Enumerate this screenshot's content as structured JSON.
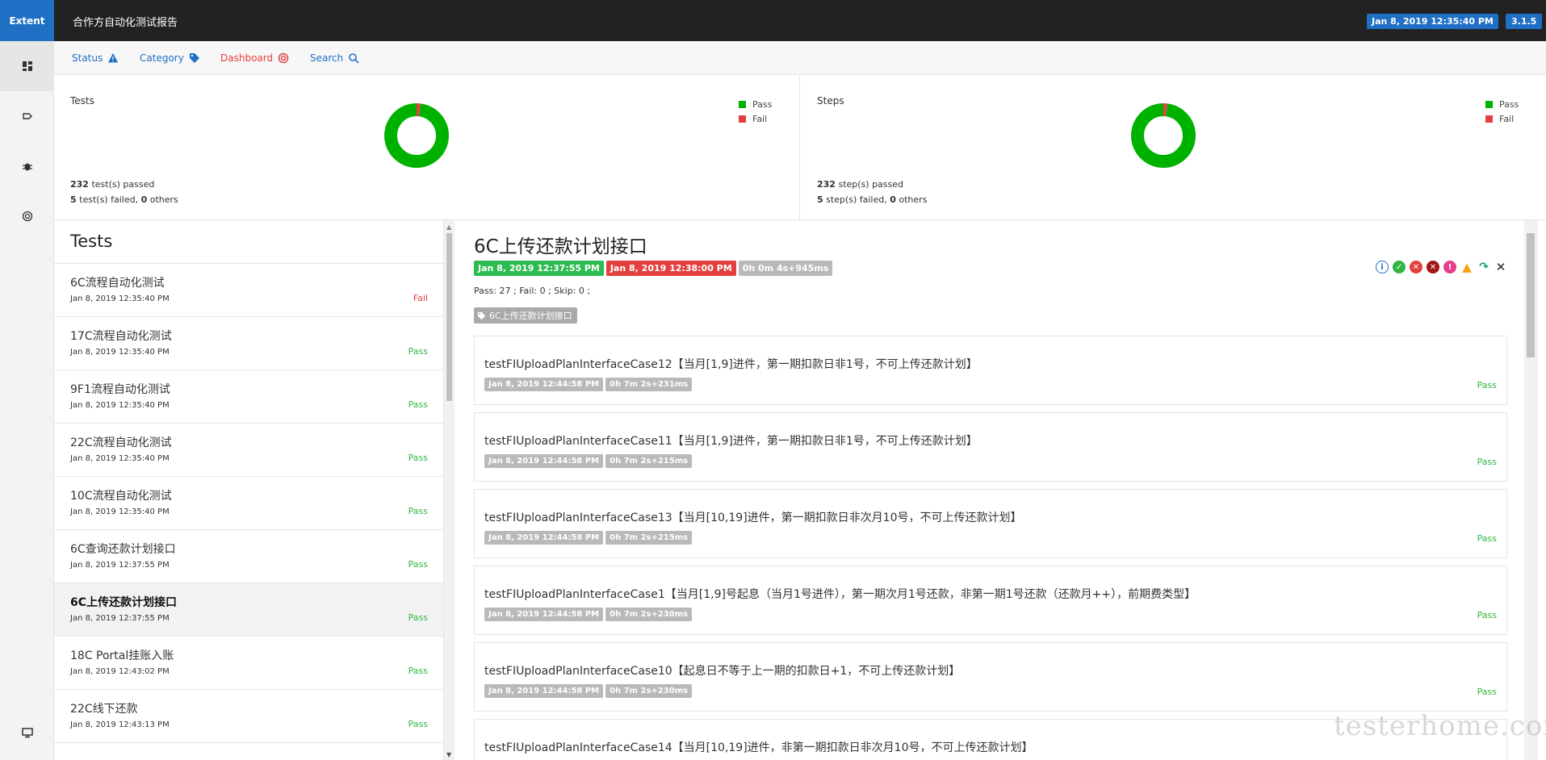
{
  "header": {
    "brand": "Extent",
    "report_name": "合作方自动化测试报告",
    "date": "Jan 8, 2019 12:35:40 PM",
    "version": "3.1.5"
  },
  "sidenav": {
    "items": [
      {
        "icon": "dashboard-grid-icon"
      },
      {
        "icon": "tag-icon"
      },
      {
        "icon": "bug-icon"
      },
      {
        "icon": "target-icon"
      },
      {
        "icon": "monitor-icon"
      }
    ]
  },
  "subnav": {
    "status": "Status",
    "category": "Category",
    "dashboard": "Dashboard",
    "search": "Search"
  },
  "colors": {
    "pass": "#00b200",
    "fail": "#e2403f",
    "accent": "#1f6fc5"
  },
  "dashboard": {
    "tests": {
      "title": "Tests",
      "legend_pass": "Pass",
      "legend_fail": "Fail",
      "passed_count": "232",
      "passed_text": " test(s) passed",
      "failed_count": "5",
      "failed_text": " test(s) failed, ",
      "others_count": "0",
      "others_text": " others",
      "pass_value": 232,
      "fail_value": 5
    },
    "steps": {
      "title": "Steps",
      "legend_pass": "Pass",
      "legend_fail": "Fail",
      "passed_count": "232",
      "passed_text": " step(s) passed",
      "failed_count": "5",
      "failed_text": " step(s) failed, ",
      "others_count": "0",
      "others_text": " others",
      "pass_value": 232,
      "fail_value": 5
    }
  },
  "chart_data": [
    {
      "type": "pie",
      "title": "Tests",
      "categories": [
        "Pass",
        "Fail"
      ],
      "values": [
        232,
        5
      ]
    },
    {
      "type": "pie",
      "title": "Steps",
      "categories": [
        "Pass",
        "Fail"
      ],
      "values": [
        232,
        5
      ]
    }
  ],
  "test_list": {
    "title": "Tests",
    "items": [
      {
        "name": "6C流程自动化测试",
        "time": "Jan 8, 2019 12:35:40 PM",
        "status": "Fail"
      },
      {
        "name": "17C流程自动化测试",
        "time": "Jan 8, 2019 12:35:40 PM",
        "status": "Pass"
      },
      {
        "name": "9F1流程自动化测试",
        "time": "Jan 8, 2019 12:35:40 PM",
        "status": "Pass"
      },
      {
        "name": "22C流程自动化测试",
        "time": "Jan 8, 2019 12:35:40 PM",
        "status": "Pass"
      },
      {
        "name": "10C流程自动化测试",
        "time": "Jan 8, 2019 12:35:40 PM",
        "status": "Pass"
      },
      {
        "name": "6C查询还款计划接口",
        "time": "Jan 8, 2019 12:37:55 PM",
        "status": "Pass"
      },
      {
        "name": "6C上传还款计划接口",
        "time": "Jan 8, 2019 12:37:55 PM",
        "status": "Pass"
      },
      {
        "name": "18C Portal挂账入账",
        "time": "Jan 8, 2019 12:43:02 PM",
        "status": "Pass"
      },
      {
        "name": "22C线下还款",
        "time": "Jan 8, 2019 12:43:13 PM",
        "status": "Pass"
      }
    ]
  },
  "detail": {
    "title": "6C上传还款计划接口",
    "start": "Jan 8, 2019 12:37:55 PM",
    "end": "Jan 8, 2019 12:38:00 PM",
    "duration": "0h 0m 4s+945ms",
    "counts": "Pass: 27 ; Fail: 0 ; Skip: 0 ;",
    "tag": "6C上传还款计划接口",
    "nodes": [
      {
        "name": "testFIUploadPlanInterfaceCase12【当月[1,9]进件，第一期扣款日非1号，不可上传还款计划】",
        "time": "Jan 8, 2019 12:44:58 PM",
        "duration": "0h 7m 2s+231ms",
        "status": "Pass"
      },
      {
        "name": "testFIUploadPlanInterfaceCase11【当月[1,9]进件，第一期扣款日非1号，不可上传还款计划】",
        "time": "Jan 8, 2019 12:44:58 PM",
        "duration": "0h 7m 2s+215ms",
        "status": "Pass"
      },
      {
        "name": "testFIUploadPlanInterfaceCase13【当月[10,19]进件，第一期扣款日非次月10号，不可上传还款计划】",
        "time": "Jan 8, 2019 12:44:58 PM",
        "duration": "0h 7m 2s+215ms",
        "status": "Pass"
      },
      {
        "name": "testFIUploadPlanInterfaceCase1【当月[1,9]号起息（当月1号进件），第一期次月1号还款，非第一期1号还款（还款月++），前期费类型】",
        "time": "Jan 8, 2019 12:44:58 PM",
        "duration": "0h 7m 2s+230ms",
        "status": "Pass"
      },
      {
        "name": "testFIUploadPlanInterfaceCase10【起息日不等于上一期的扣款日+1，不可上传还款计划】",
        "time": "Jan 8, 2019 12:44:58 PM",
        "duration": "0h 7m 2s+230ms",
        "status": "Pass"
      },
      {
        "name": "testFIUploadPlanInterfaceCase14【当月[10,19]进件，非第一期扣款日非次月10号，不可上传还款计划】",
        "time": "",
        "duration": "",
        "status": ""
      }
    ]
  }
}
